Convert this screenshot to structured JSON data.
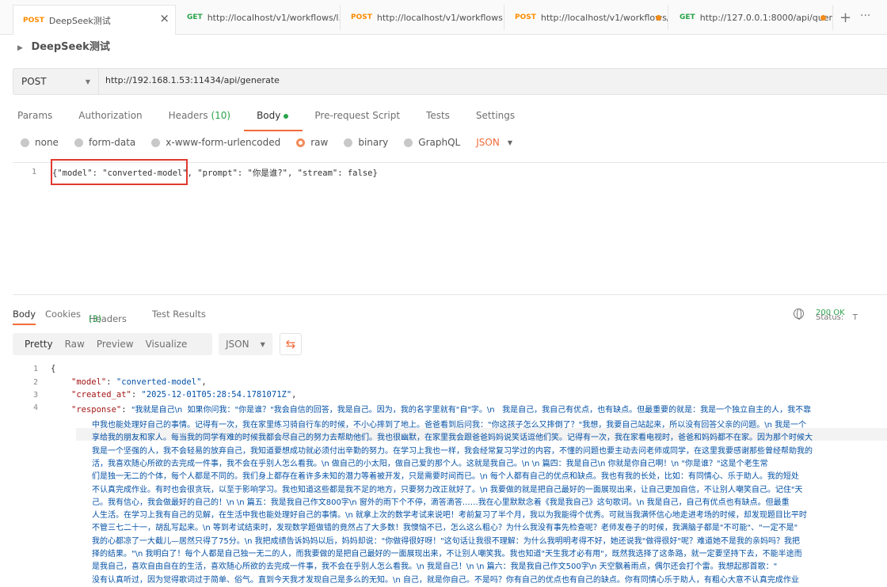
{
  "tabs": [
    {
      "method": "POST",
      "title": "DeepSeek测试",
      "close": "×"
    },
    {
      "method": "GET",
      "title": "http://localhost/v1/workflows/l..."
    },
    {
      "method": "POST",
      "title": "http://localhost/v1/workflows..."
    },
    {
      "method": "POST",
      "title": "http://localhost/v1/workflows/..."
    },
    {
      "method": "GET",
      "title": "http://127.0.0.1:8000/api/query"
    }
  ],
  "tab_plus": "+",
  "tab_more": "···",
  "breadcrumb": {
    "title": "DeepSeek测试"
  },
  "request": {
    "method": "POST",
    "url": "http://192.168.1.53:11434/api/generate",
    "tabs": {
      "params": "Params",
      "authorization": "Authorization",
      "headers": "Headers",
      "headers_count": "(10)",
      "body": "Body",
      "prerequest": "Pre-request Script",
      "tests": "Tests",
      "settings": "Settings"
    },
    "body_types": [
      "none",
      "form-data",
      "x-www-form-urlencoded",
      "raw",
      "binary",
      "GraphQL"
    ],
    "selected_body_type": "raw",
    "format": "JSON",
    "body_line_number": "1",
    "body_text": "{\"model\": \"converted-model\", \"prompt\": \"你是谁?\", \"stream\": false}"
  },
  "response": {
    "tabs": {
      "body": "Body",
      "cookies": "Cookies",
      "headers": "Headers",
      "headers_count": "(3)",
      "test_results": "Test Results"
    },
    "status_label": "Status:",
    "status_value": "200 OK",
    "status_extra": "T",
    "view_modes": [
      "Pretty",
      "Raw",
      "Preview",
      "Visualize"
    ],
    "format": "JSON",
    "line_numbers": [
      "1",
      "2",
      "3",
      "4"
    ],
    "lines": {
      "l1": "{",
      "l2_key": "\"model\"",
      "l2_val": "\"converted-model\"",
      "l3_key": "\"created_at\"",
      "l3_val": "\"2025-12-01T05:28:54.1781071Z\"",
      "l4_key": "\"response\"",
      "l4_val": "\"我就是自己\\n  如果你问我：\"你是谁？\"我会自信的回答，我是自己。因为，我的名字里就有\"自\"字。\\n   我是自己，我自己有优点，也有缺点。但最重要的就是：我是一个独立自主的人，我不靠"
    },
    "wrapped": [
      "中我也能处理好自己的事情。记得有一次，我在家里练习骑自行车的时候，不小心摔到了地上。爸爸看到后问我：\"你这孩子怎么又摔倒了？\"我想，我要自己站起来，所以没有回答父亲的问题。\\n   我是一个",
      "享给我的朋友和家人。每当我的同学有难的时候我都会尽自己的努力去帮助他们。我也很幽默，在家里我会跟爸爸妈妈说笑话逗他们笑。记得有一次，我在家看电视时，爸爸和妈妈都不在家。因为那个时候大",
      "我是一个坚强的人，我不会轻易的放弃自己，我知道要想成功就必须付出辛勤的努力。在学习上我也一样，我会经常复习学过的内容，不懂的问题也要主动去问老师或同学，在这里我要感谢那些曾经帮助我的",
      "活，我喜欢随心所欲的去完成一件事，我不会在乎别人怎么看我。\\n   做自己的小太阳，做自己爱的那个人。这就是我自己。\\n   \\n    篇四：我是自己\\n   你就是你自己啊！\\n   \"你是谁？\"这是个老生常",
      "们是独一无二的个体，每个人都是不同的。我们身上都存在着许多未知的潜力等着被开发，只是需要时间而已。\\n   每个人都有自己的优点和缺点。我也有我的长处，比如：有同情心、乐于助人。我的短处",
      "不认真完成作业。有时也会很贪玩，以至于影响学习。我也知道这些都是我不足的地方，只要努力改正就好了。\\n   我要做的就是把自己最好的一面展现出来，让自己更加自信，不让别人嘲笑自己。记住\"天",
      "己。我有信心，我会做最好的自己的！\\n   \\n    篇五：我是我自己作文800字\\n   窗外的雨下个不停，滴答滴答……我在心里默默念着《我是我自己》这句歌词。\\n   我是自己，自己有优点也有缺点。但最重",
      "人生活。在学习上我有自己的见解，在生活中我也能处理好自己的事情。\\n   就拿上次的数学考试来说吧！考前复习了半个月，我以为我能得个优秀。可就当我满怀信心地走进考场的时候，却发现题目比平时",
      "不管三七二十一，胡乱写起来。\\n   等到考试结束时，发现数学题做错的竟然占了大多数！我懊恼不已，怎么这么粗心？为什么我没有事先检查呢？老师发卷子的时候，我满脑子都是\"不可能\"、\"一定不是\"",
      "我的心都凉了一大截儿—居然只得了75分。\\n   我把成绩告诉妈妈以后，妈妈却说：\"你做得很好呀！\"这句话让我很不理解：为什么我明明考得不好，她还说我\"做得很好\"呢？难道她不是我的亲妈吗？我把",
      "择的结果。\"\\n   我明白了！每个人都是自己独一无二的人，而我要做的是把自己最好的一面展现出来，不让别人嘲笑我。我也知道\"天生我才必有用\"，既然我选择了这条路，就一定要坚持下去，不能半途而",
      "是我自己，喜欢自由自在的生活，喜欢随心所欲的去完成一件事，我不会在乎别人怎么看我。\\n   我是自己！\\n   \\n    篇六：我是我自己作文500字\\n   天空飘着雨点，偶尔还会打个雷。我想起那首歌：\"",
      "没有认真听过，因为觉得歌词过于简单、俗气。直到今天我才发现自己是多么的无知。\\n   自己，就是你自己。不是吗？你有自己的优点也有自己的缺点。你有同情心乐于助人，有粗心大意不认真完成作业"
    ]
  }
}
